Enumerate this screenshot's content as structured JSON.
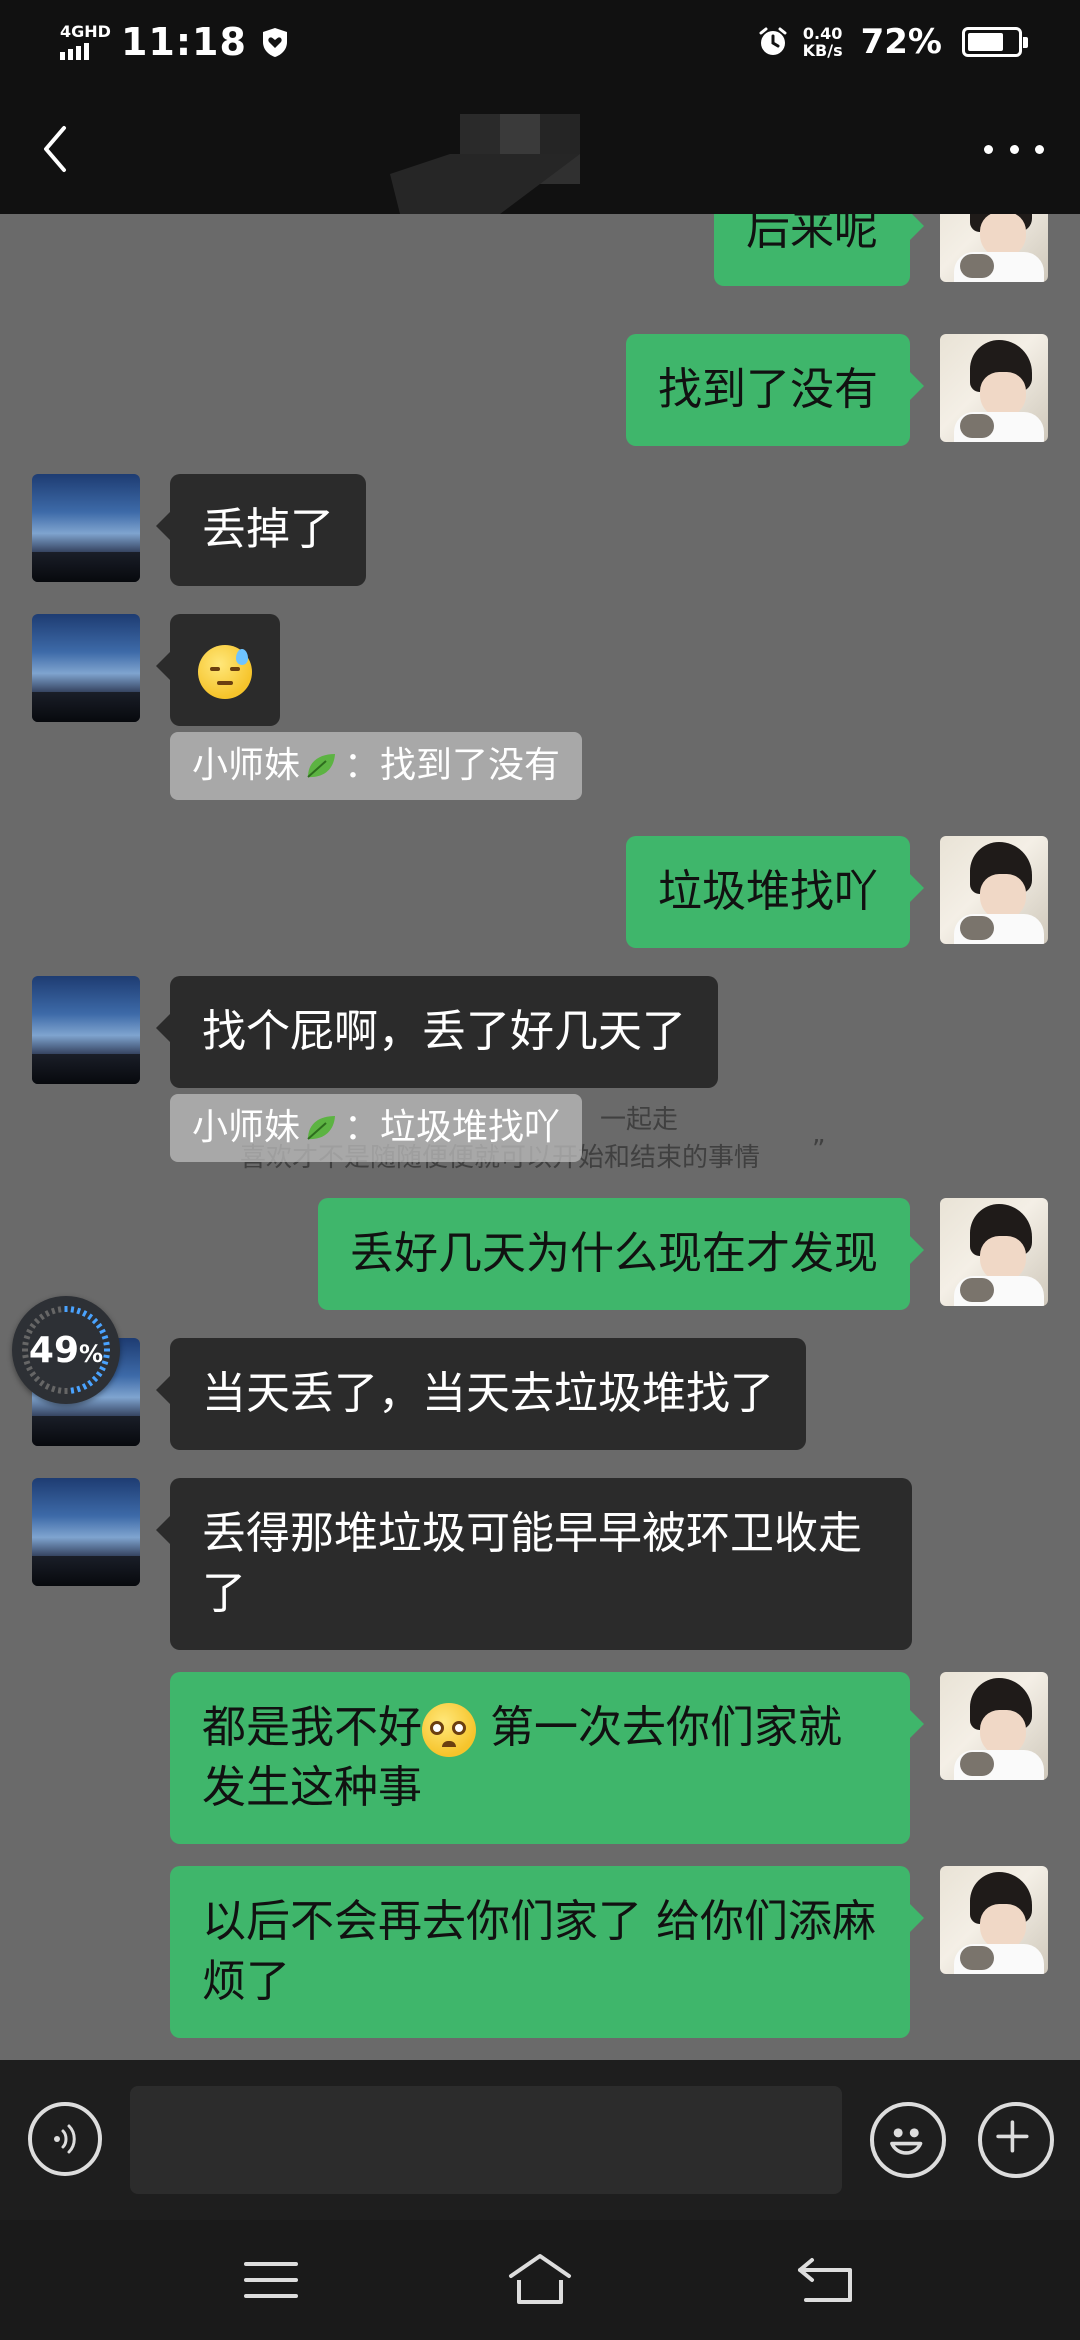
{
  "status_bar": {
    "network": "4GHD",
    "time": "11:18",
    "speed_value": "0.40",
    "speed_unit": "KB/s",
    "battery": "72%",
    "battery_level": 0.72
  },
  "messages": [
    {
      "side": "right",
      "text": "后来呢"
    },
    {
      "side": "right",
      "text": "找到了没有"
    },
    {
      "side": "left",
      "text": "丢掉了"
    },
    {
      "side": "left",
      "emoji": "sweat-face"
    },
    {
      "side": "right",
      "text": "垃圾堆找吖"
    },
    {
      "side": "left",
      "text": "找个屁啊，丢了好几天了"
    },
    {
      "side": "right",
      "text": "丢好几天为什么现在才发现"
    },
    {
      "side": "left",
      "text": "当天丢了，当天去垃圾堆找了"
    },
    {
      "side": "left",
      "text": "丢得那堆垃圾可能早早被环卫收走了"
    },
    {
      "side": "right",
      "text_a": "都是我不好",
      "text_b": " 第一次去你们家就发生这种事"
    },
    {
      "side": "right",
      "text": "以后不会再去你们家了 给你们添麻烦了"
    }
  ],
  "quotes": [
    {
      "name": "小师妹",
      "sep": "：",
      "text": "找到了没有"
    },
    {
      "name": "小师妹",
      "sep": "：",
      "text": "垃圾堆找吖"
    }
  ],
  "watermark": {
    "line1": "一起走",
    "line2": "喜欢才不是随随便便就可以开始和结束的事情",
    "quote_mark": "”"
  },
  "progress": {
    "value": 49,
    "label": "49",
    "unit": "%"
  },
  "input": {
    "value": "",
    "placeholder": ""
  },
  "colors": {
    "outgoing_bubble": "#3fb66b",
    "incoming_bubble": "#2b2b2b",
    "chat_bg": "#6a6a6a"
  }
}
